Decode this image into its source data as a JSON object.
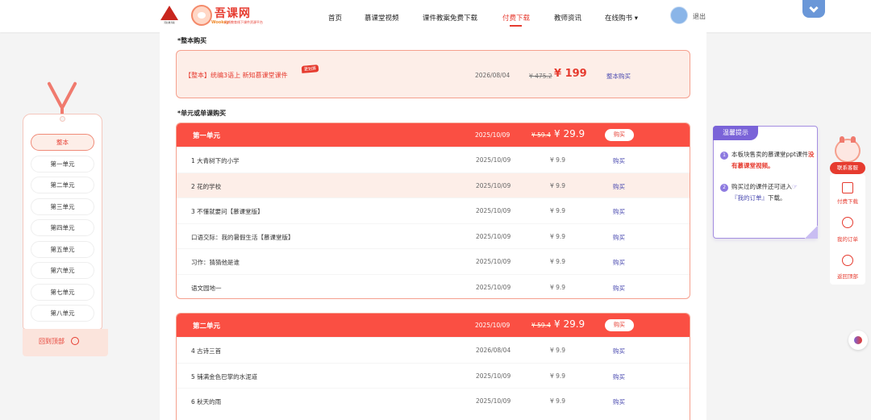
{
  "header": {
    "logo_small": "河北教育版",
    "brand_name": "吾课网",
    "brand_en": "Wookey",
    "brand_tag": "无线教育线下课件资源平台",
    "nav": [
      {
        "label": "首页",
        "active": false
      },
      {
        "label": "慕课堂视频",
        "active": false
      },
      {
        "label": "课件教案免费下载",
        "active": false
      },
      {
        "label": "付费下载",
        "active": true
      },
      {
        "label": "教师资讯",
        "active": false
      },
      {
        "label": "在线购书 ▾",
        "active": false
      }
    ],
    "logout": "退出"
  },
  "whole_section": {
    "title": "*整本购买",
    "item": {
      "name": "【整本】统编3语上 新知慕课堂课件",
      "badge": "更划算",
      "date": "2026/08/04",
      "old_price": "¥ 475.2",
      "new_price": "¥ 199",
      "buy": "整本购买"
    }
  },
  "unit_section_title": "*单元或单课购买",
  "units": [
    {
      "name": "第一单元",
      "date": "2025/10/09",
      "old_price": "¥ 59.4",
      "new_price": "¥ 29.9",
      "buy": "购买",
      "lessons": [
        {
          "title": "1 大青树下的小学",
          "date": "2025/10/09",
          "price": "¥ 9.9",
          "buy": "购买"
        },
        {
          "title": "2 花的学校",
          "date": "2025/10/09",
          "price": "¥ 9.9",
          "buy": "购买"
        },
        {
          "title": "3 不懂就要问【慕课堂版】",
          "date": "2025/10/09",
          "price": "¥ 9.9",
          "buy": "购买"
        },
        {
          "title": "口语交际：我的暑假生活【慕课堂版】",
          "date": "2025/10/09",
          "price": "¥ 9.9",
          "buy": "购买"
        },
        {
          "title": "习作：猜猜他是谁",
          "date": "2025/10/09",
          "price": "¥ 9.9",
          "buy": "购买"
        },
        {
          "title": "语文园地一",
          "date": "2025/10/09",
          "price": "¥ 9.9",
          "buy": "购买"
        }
      ]
    },
    {
      "name": "第二单元",
      "date": "2025/10/09",
      "old_price": "¥ 59.4",
      "new_price": "¥ 29.9",
      "buy": "购买",
      "lessons": [
        {
          "title": "4 古诗三首",
          "date": "2026/08/04",
          "price": "¥ 9.9",
          "buy": "购买"
        },
        {
          "title": "5 铺满金色巴掌的水泥道",
          "date": "2025/10/09",
          "price": "¥ 9.9",
          "buy": "购买"
        },
        {
          "title": "6 秋天的雨",
          "date": "2025/10/09",
          "price": "¥ 9.9",
          "buy": "购买"
        }
      ]
    }
  ],
  "sidebar": {
    "items": [
      "整本",
      "第一单元",
      "第二单元",
      "第三单元",
      "第四单元",
      "第五单元",
      "第六单元",
      "第七单元",
      "第八单元"
    ],
    "back_to_top": "回到顶部"
  },
  "tips": {
    "title": "温馨提示",
    "tip1_a": "本板块售卖的慕课堂ppt课件",
    "tip1_b": "没有慕课堂视频。",
    "tip2_a": "购买过的课件还可进入",
    "tip2_b": "『我的订单』",
    "tip2_c": "下载。"
  },
  "right_bar": {
    "contact": "联系客服",
    "items": [
      "付费下载",
      "我的订单",
      "返回顶部"
    ]
  }
}
